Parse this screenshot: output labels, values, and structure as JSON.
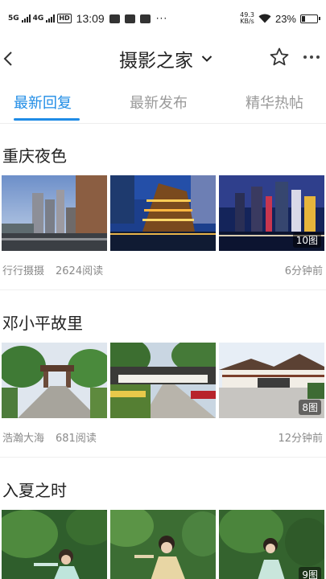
{
  "status_bar": {
    "signal1": "5G",
    "signal2": "4G",
    "hd": "HD",
    "time": "13:09",
    "more": "···",
    "speed_top": "49.3",
    "speed_unit": "KB/s",
    "battery_pct": "23%",
    "battery_level": 0.23
  },
  "header": {
    "title": "摄影之家"
  },
  "tabs": [
    {
      "label": "最新回复",
      "active": true
    },
    {
      "label": "最新发布",
      "active": false
    },
    {
      "label": "精华热帖",
      "active": false
    }
  ],
  "posts": [
    {
      "title": "重庆夜色",
      "author": "行行摄摄",
      "reads": "2624阅读",
      "time": "6分钟前",
      "badge": "10图"
    },
    {
      "title": "邓小平故里",
      "author": "浩瀚大海",
      "reads": "681阅读",
      "time": "12分钟前",
      "badge": "8图"
    },
    {
      "title": "入夏之时",
      "author": "",
      "reads": "",
      "time": "",
      "badge": "9图"
    }
  ],
  "colors": {
    "accent": "#1f8ce6",
    "muted": "#8a8a8a"
  }
}
